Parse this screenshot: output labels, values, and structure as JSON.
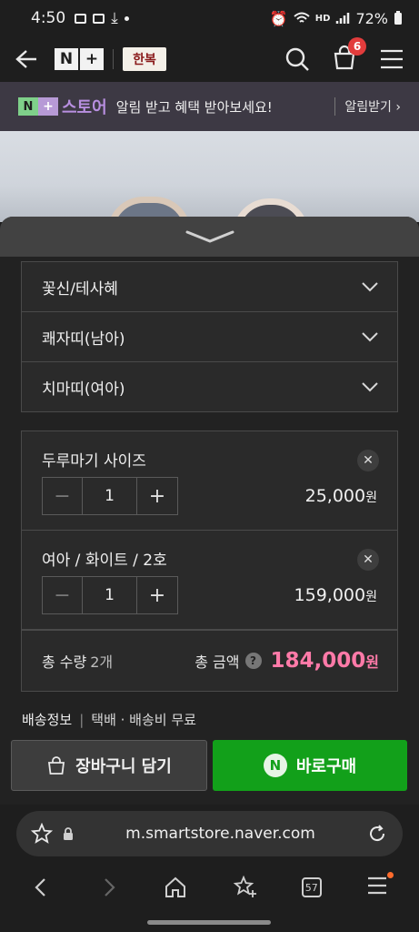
{
  "status_bar": {
    "time": "4:50",
    "network": "HD",
    "battery": "72%"
  },
  "header": {
    "brand": "N+",
    "brand_n": "N",
    "brand_plus": "+",
    "shop_logo_text": "한복",
    "cart_count": "6"
  },
  "banner": {
    "badge_n": "N",
    "badge_plus": "+",
    "badge_text": "스토어",
    "message": "알림 받고 혜택 받아보세요!",
    "button": "알림받기"
  },
  "options": [
    {
      "label": "꽃신/테사혜"
    },
    {
      "label": "쾌자띠(남아)"
    },
    {
      "label": "치마띠(여아)"
    }
  ],
  "selected_items": [
    {
      "name": "두루마기 사이즈",
      "quantity": "1",
      "price": "25,000",
      "unit": "원"
    },
    {
      "name": "여아 / 화이트 / 2호",
      "quantity": "1",
      "price": "159,000",
      "unit": "원"
    }
  ],
  "total": {
    "qty_label": "총 수량",
    "qty_value": "2개",
    "amount_label": "총 금액",
    "help": "?",
    "amount": "184,000",
    "unit": "원"
  },
  "delivery": {
    "label": "배송정보",
    "separator": "|",
    "text": "택배 · 배송비 무료"
  },
  "actions": {
    "cart_label": "장바구니 담기",
    "buy_label": "바로구매",
    "buy_badge": "N"
  },
  "browser": {
    "url": "m.smartstore.naver.com",
    "tab_count": "57"
  },
  "colors": {
    "accent_green": "#12a01a",
    "price_pink": "#ff7aa8",
    "badge_red": "#e23c3c"
  }
}
